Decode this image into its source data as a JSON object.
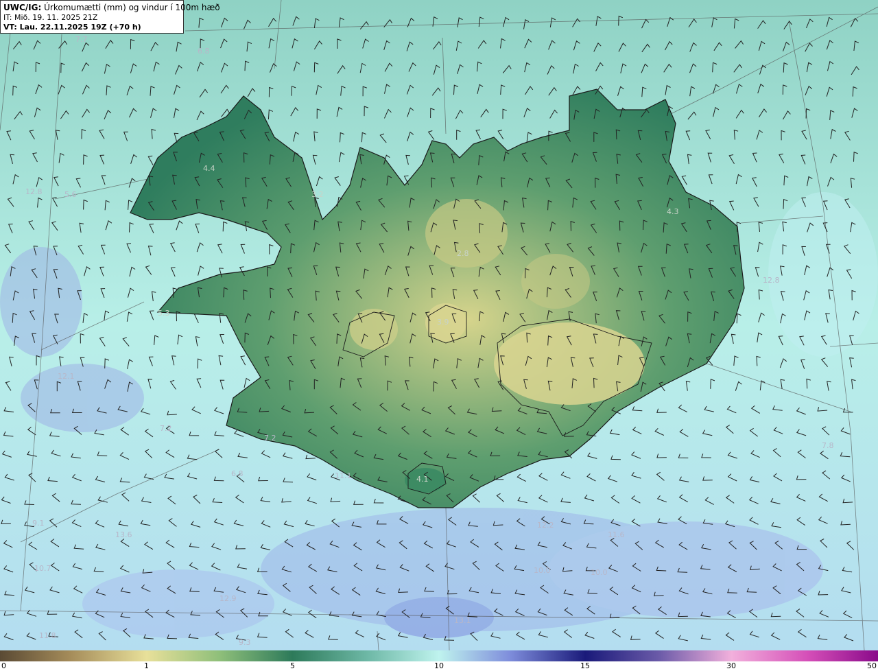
{
  "header": {
    "title_bold": "UWC/IG:",
    "title_rest": " Úrkomumætti (mm) og vindur í 100m hæð",
    "issue_time": "IT: Mið. 19. 11. 2025 21Z",
    "valid_label": "VT: Lau. 22.11.2025 19Z (+70 h)"
  },
  "colorbar": {
    "ticks": [
      "0",
      "1",
      "5",
      "10",
      "15",
      "30",
      "50"
    ],
    "colors": [
      "#6b5a3e",
      "#e8e09a",
      "#2d7a5a",
      "#bff3ee",
      "#1a1a7a",
      "#f2b0dc",
      "#8a0a8a"
    ]
  },
  "map_values": [
    "7.7",
    "6.8",
    "4.4",
    "3.2",
    "12.8",
    "2.8",
    "4.3",
    "3.9",
    "5.3",
    "12.8",
    "12.1",
    "7.2",
    "7.2",
    "6.8",
    "4.1",
    "11.1",
    "9.1",
    "13.6",
    "10.7",
    "12.2",
    "11.6",
    "10.0",
    "10.0",
    "12.9",
    "13.1",
    "9.3",
    "11.8",
    "7.8",
    "5.6"
  ],
  "colors": {
    "ocean": "#a7e3df",
    "land_low": "#2f7d5e",
    "land_high": "#d6d48c",
    "coast": "#1a1a1a"
  }
}
